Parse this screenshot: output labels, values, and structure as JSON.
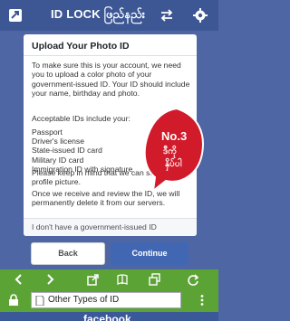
{
  "header": {
    "title": "ID LOCK ဖြည်နည်း"
  },
  "card": {
    "title": "Upload Your Photo ID",
    "intro": "To make sure this is your account, we need you to upload a color photo of your government-issued ID. Your ID should include your name, birthday and photo.",
    "list_heading": "Acceptable IDs include your:",
    "acceptable_ids": [
      "Passport",
      "Driver's license",
      "State-issued ID card",
      "Military ID card",
      "Immigration ID with signature"
    ],
    "profile_note": "Please keep in mind that we can see your profile picture.",
    "verify_note": "Once we receive and review the ID, we will permanently delete it from our servers.",
    "no_id_link": "I don't have a government-issued ID"
  },
  "annotation": {
    "line1": "No.3",
    "line2": "ဒီကို",
    "line3": "နှိပ်ပါ"
  },
  "actions": {
    "back_label": "Back",
    "continue_label": "Continue"
  },
  "browser": {
    "url_text": "Other Types of ID"
  },
  "footer": {
    "brand": "facebook"
  },
  "colors": {
    "app_bar": "#3d5795",
    "background": "#4e67a4",
    "browser_bar": "#5ca335",
    "continue_button": "#4267b2",
    "annotation_badge": "#d11a2a"
  }
}
